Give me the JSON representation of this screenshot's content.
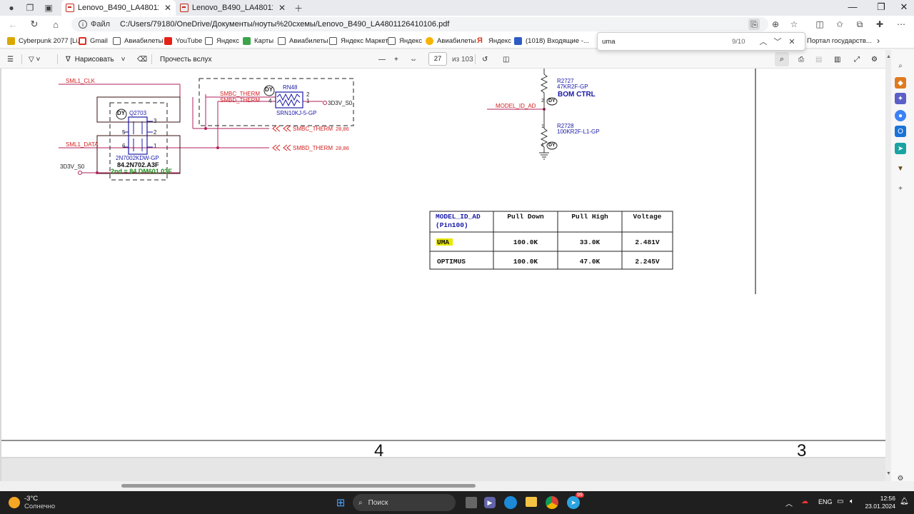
{
  "browser": {
    "tabs": [
      {
        "title": "Lenovo_B490_LA4801126410106",
        "active": true
      },
      {
        "title": "Lenovo_B490_LA4801126410106",
        "active": false
      }
    ],
    "address": {
      "scheme_label": "Файл",
      "url": "C:/Users/79180/OneDrive/Документы/ноуты%20схемы/Lenovo_B490_LA4801126410106.pdf"
    },
    "bookmarks": [
      {
        "label": "Cyberpunk 2077 [Li...",
        "icon": "game-icon"
      },
      {
        "label": "Gmail",
        "icon": "gmail-icon"
      },
      {
        "label": "Авиабилеты",
        "icon": "page-icon"
      },
      {
        "label": "YouTube",
        "icon": "youtube-icon"
      },
      {
        "label": "Яндекс",
        "icon": "page-icon"
      },
      {
        "label": "Карты",
        "icon": "maps-icon"
      },
      {
        "label": "Авиабилеты",
        "icon": "page-icon"
      },
      {
        "label": "Яндекс Маркет",
        "icon": "page-icon"
      },
      {
        "label": "Яндекс",
        "icon": "page-icon"
      },
      {
        "label": "Авиабилеты",
        "icon": "sun-icon"
      },
      {
        "label": "Яндекс",
        "icon": "yandex-icon"
      },
      {
        "label": "(1018) Входящие -...",
        "icon": "mail-icon"
      }
    ],
    "bookmark_overflow": "Портал государств...",
    "find": {
      "query": "uma",
      "count": "9/10"
    }
  },
  "pdf_toolbar": {
    "draw_label": "Нарисовать",
    "read_aloud_label": "Прочесть вслух",
    "page_current": "27",
    "page_total": "из 103"
  },
  "schematic": {
    "left": {
      "sml1_clk": "SML1_CLK",
      "sml1_data": "SML1_DATA",
      "vcc": "3D3V_S0",
      "q_ref": "Q2703",
      "q_part": "2N7002KDW-GP",
      "q_pn": "84.2N702.A3F",
      "q_second": "2nd = 84.DM601.03F",
      "pins": [
        "3",
        "5",
        "2",
        "6",
        "1"
      ],
      "rn_ref": "RN48",
      "rn_part": "SRN10KJ-5-GP",
      "rn_pins": [
        "2",
        "1",
        "4"
      ],
      "rn_vcc": "3D3V_S0",
      "smbc": "SMBC_THERM",
      "smbd": "SMBD_THERM",
      "smbc_out": "SMBC_THERM",
      "smbd_out": "SMBD_THERM",
      "ref_num": "28,86",
      "dummy": "DY"
    },
    "right": {
      "r1_ref": "R2727",
      "r1_val": "47KR2F-GP",
      "bom": "BOM CTRL",
      "net": "MODEL_ID_AD",
      "r2_ref": "R2728",
      "r2_val": "100KR2F-L1-GP",
      "pin1": "1",
      "pin2": "2",
      "pin_a": "2",
      "pin_b": "1",
      "badge": "DY"
    },
    "page_markers": [
      "4",
      "3"
    ]
  },
  "model_table": {
    "headers": [
      "MODEL_ID_AD (Pin100)",
      "Pull Down",
      "Pull High",
      "Voltage"
    ],
    "rows": [
      [
        "UMA",
        "100.0K",
        "33.0K",
        "2.481V"
      ],
      [
        "OPTIMUS",
        "100.0K",
        "47.0K",
        "2.245V"
      ]
    ]
  },
  "taskbar": {
    "weather_temp": "-3°C",
    "weather_desc": "Солнечно",
    "search_placeholder": "Поиск",
    "lang": "ENG",
    "time": "12:56",
    "date": "23.01.2024",
    "badge": "99"
  },
  "colors": {
    "wire": "#b0225a",
    "net_red": "#d42020",
    "part_blue": "#1a1aa8",
    "green": "#1a8a1a",
    "find_highlight": "#e8e800"
  }
}
